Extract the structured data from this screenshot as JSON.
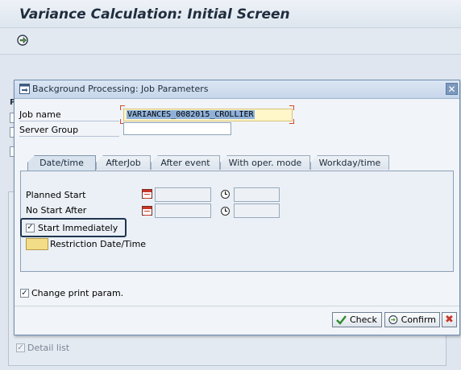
{
  "main": {
    "title": "Variance Calculation: Initial Screen",
    "detail_list_label": "Detail list",
    "side_letter": "P"
  },
  "dialog": {
    "title": "Background Processing: Job Parameters",
    "close_symbol": "✕",
    "job_name_label": "Job name",
    "job_name_value": "VARIANCES_0082015_CROLLIER",
    "server_group_label": "Server Group",
    "server_group_value": "",
    "tabs": [
      {
        "label": "Date/time",
        "active": true
      },
      {
        "label": "AfterJob",
        "active": false
      },
      {
        "label": "After event",
        "active": false
      },
      {
        "label": "With oper. mode",
        "active": false
      },
      {
        "label": "Workday/time",
        "active": false
      }
    ],
    "planned_start_label": "Planned Start",
    "no_start_after_label": "No Start After",
    "start_immediately_label": "Start Immediately",
    "start_immediately_checked": true,
    "restriction_label": "Restriction Date/Time",
    "change_print_label": "Change print param.",
    "change_print_checked": true,
    "check_label": "Check",
    "confirm_label": "Confirm",
    "cancel_symbol": "✖"
  },
  "colors": {
    "accent": "#6f8db3",
    "highlight_box": "#1f3450",
    "job_field_bg": "#fff6c9",
    "check_green": "#2e8b2e",
    "cancel_red": "#c8372a"
  },
  "icons": [
    "execute-icon",
    "dialog-icon",
    "calendar-icon",
    "clock-icon",
    "check-icon",
    "confirm-icon",
    "cancel-icon"
  ]
}
